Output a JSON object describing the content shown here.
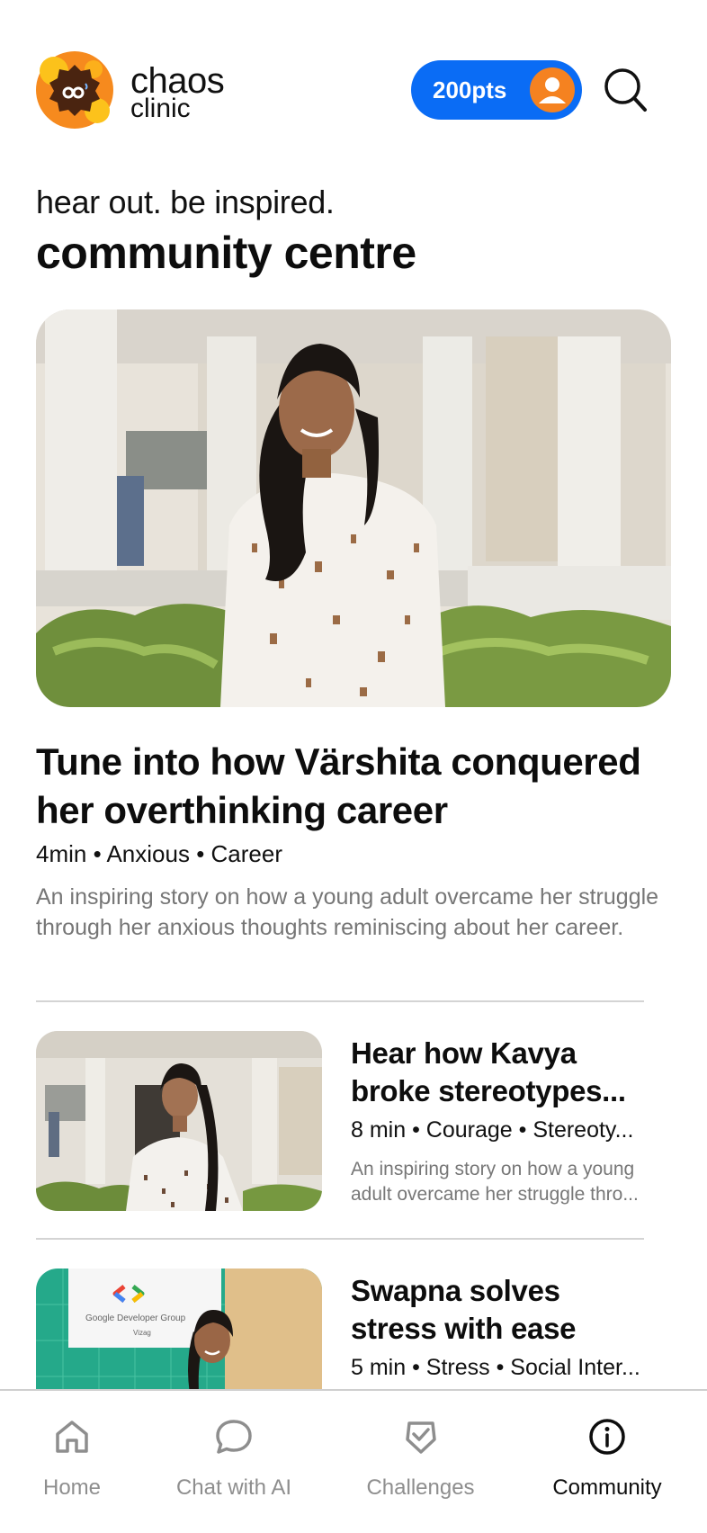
{
  "brand": {
    "name": "chaos",
    "sub": "clinic",
    "logo_icon": "chaos-clinic-logo"
  },
  "header": {
    "points_label": "200pts",
    "avatar_icon": "user-avatar-icon",
    "search_icon": "search-icon",
    "accent_color": "#0a6cf5"
  },
  "hero": {
    "tagline": "hear out. be inspired.",
    "title": "community centre"
  },
  "feature": {
    "title": "Tune into how Värshita conquered her overthinking career",
    "meta": "4min • Anxious • Career",
    "description": "An inspiring story on how a young adult overcame her struggle through her anxious thoughts reminiscing about her career."
  },
  "stories": [
    {
      "title_line1": "Hear how Kavya",
      "title_line2": "broke stereotypes...",
      "meta": "8 min • Courage • Stereoty...",
      "desc_line1": "An inspiring story on how a young",
      "desc_line2": "adult overcame her struggle thro..."
    },
    {
      "title_line1": "Swapna solves",
      "title_line2": "stress with ease",
      "meta": "5 min • Stress • Social Inter...",
      "thumb_banner_text": "Google Developer Group",
      "thumb_banner_sub": "Vizag"
    }
  ],
  "nav": [
    {
      "label": "Home",
      "icon": "home-icon",
      "active": false
    },
    {
      "label": "Chat with AI",
      "icon": "chat-bubble-icon",
      "active": false
    },
    {
      "label": "Challenges",
      "icon": "badge-check-icon",
      "active": false
    },
    {
      "label": "Community",
      "icon": "info-circle-icon",
      "active": true
    }
  ]
}
